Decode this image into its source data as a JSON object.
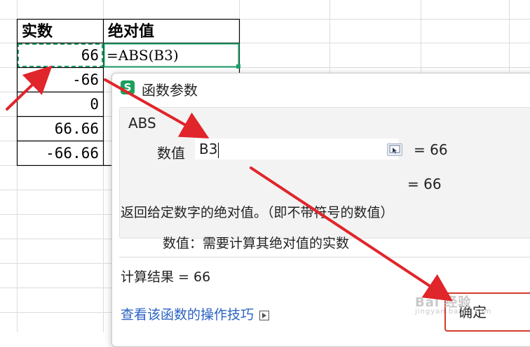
{
  "sheet": {
    "headers": [
      "实数",
      "绝对值"
    ],
    "values": [
      "66",
      "-66",
      "0",
      "66.66",
      "-66.66"
    ],
    "formula": "=ABS(B3)"
  },
  "dialog": {
    "icon_letter": "S",
    "title": "函数参数",
    "function_name": "ABS",
    "arg_label": "数值",
    "arg_input_value": "B3",
    "arg_value": "= 66",
    "result_preview": "= 66",
    "description": "返回给定数字的绝对值。（即不带符号的数值）",
    "param_description": "数值：需要计算其绝对值的实数",
    "calc_result": "计算结果 = 66",
    "tips_link": "查看该函数的操作技巧",
    "ok_label": "确定"
  },
  "watermark": {
    "text": "Bai 经验",
    "sub": "jingyan.baidu.com"
  },
  "colors": {
    "accent_green": "#1aa05c",
    "selection_dash": "#1f9e6a",
    "annotation_red": "#e0252b",
    "link_blue": "#2a62c4"
  },
  "icons": [
    "sheet-app-icon",
    "range-select-icon",
    "tips-video-icon"
  ]
}
